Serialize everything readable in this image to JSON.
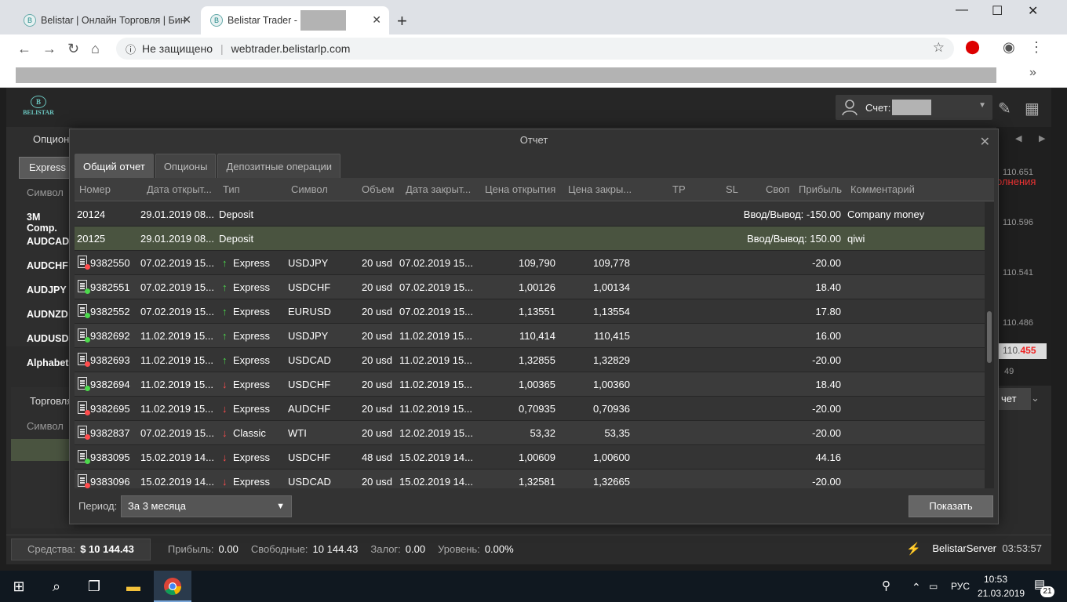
{
  "browser": {
    "tabs": [
      {
        "title": "Belistar | Онлайн Торговля | Бин"
      },
      {
        "title": "Belistar Trader -"
      }
    ],
    "security": "Не защищено",
    "url": "webtrader.belistarlp.com"
  },
  "app": {
    "logo": "BELISTAR",
    "account_label": "Счет:",
    "left_panel": {
      "title": "Опцион",
      "express": "Express",
      "column": "Символ",
      "symbols": [
        "3M Comp.",
        "AUDCAD",
        "AUDCHF",
        "AUDJPY",
        "AUDNZD",
        "AUDUSD",
        "Alphabet ."
      ]
    },
    "left_panel2": {
      "title": "Торговля",
      "column": "Символ"
    },
    "right_prices": [
      "110.651",
      "олнения",
      "110.596",
      "110.541",
      "110.486",
      "110.",
      "455",
      "49"
    ],
    "report_button_partial": "чет",
    "bottom": {
      "funds_label": "Средства:",
      "funds_value": "$ 10 144.43",
      "profit_label": "Прибыль:",
      "profit_value": "0.00",
      "free_label": "Свободные:",
      "free_value": "10 144.43",
      "margin_label": "Залог:",
      "margin_value": "0.00",
      "level_label": "Уровень:",
      "level_value": "0.00%",
      "server": "BelistarServer",
      "time": "03:53:57"
    }
  },
  "modal": {
    "title": "Отчет",
    "tabs": [
      "Общий отчет",
      "Опционы",
      "Депозитные операции"
    ],
    "columns": [
      "Номер",
      "Дата открыт...",
      "Тип",
      "Символ",
      "Объем",
      "Дата закрыт...",
      "Цена открытия",
      "Цена закры...",
      "TP",
      "SL",
      "Своп",
      "Прибыль",
      "Комментарий"
    ],
    "rows": [
      {
        "num": "20124",
        "open": "29.01.2019 08...",
        "dir": "",
        "type": "Deposit",
        "symbol": "",
        "vol": "",
        "close": "",
        "po": "",
        "pc": "",
        "profit": "Ввод/Вывод: -150.00",
        "comment": "Company money",
        "icon": false
      },
      {
        "num": "20125",
        "open": "29.01.2019 08...",
        "dir": "",
        "type": "Deposit",
        "symbol": "",
        "vol": "",
        "close": "",
        "po": "",
        "pc": "",
        "profit": "Ввод/Вывод: 150.00",
        "comment": "qiwi",
        "icon": false
      },
      {
        "num": "9382550",
        "open": "07.02.2019 15...",
        "dir": "up",
        "type": "Express",
        "symbol": "USDJPY",
        "vol": "20 usd",
        "close": "07.02.2019 15...",
        "po": "109,790",
        "pc": "109,778",
        "profit": "-20.00",
        "comment": "",
        "icon": true,
        "win": false
      },
      {
        "num": "9382551",
        "open": "07.02.2019 15...",
        "dir": "up",
        "type": "Express",
        "symbol": "USDCHF",
        "vol": "20 usd",
        "close": "07.02.2019 15...",
        "po": "1,00126",
        "pc": "1,00134",
        "profit": "18.40",
        "comment": "",
        "icon": true,
        "win": true
      },
      {
        "num": "9382552",
        "open": "07.02.2019 15...",
        "dir": "up",
        "type": "Express",
        "symbol": "EURUSD",
        "vol": "20 usd",
        "close": "07.02.2019 15...",
        "po": "1,13551",
        "pc": "1,13554",
        "profit": "17.80",
        "comment": "",
        "icon": true,
        "win": true
      },
      {
        "num": "9382692",
        "open": "11.02.2019 15...",
        "dir": "up",
        "type": "Express",
        "symbol": "USDJPY",
        "vol": "20 usd",
        "close": "11.02.2019 15...",
        "po": "110,414",
        "pc": "110,415",
        "profit": "16.00",
        "comment": "",
        "icon": true,
        "win": true
      },
      {
        "num": "9382693",
        "open": "11.02.2019 15...",
        "dir": "up",
        "type": "Express",
        "symbol": "USDCAD",
        "vol": "20 usd",
        "close": "11.02.2019 15...",
        "po": "1,32855",
        "pc": "1,32829",
        "profit": "-20.00",
        "comment": "",
        "icon": true,
        "win": false
      },
      {
        "num": "9382694",
        "open": "11.02.2019 15...",
        "dir": "down",
        "type": "Express",
        "symbol": "USDCHF",
        "vol": "20 usd",
        "close": "11.02.2019 15...",
        "po": "1,00365",
        "pc": "1,00360",
        "profit": "18.40",
        "comment": "",
        "icon": true,
        "win": true
      },
      {
        "num": "9382695",
        "open": "11.02.2019 15...",
        "dir": "down",
        "type": "Express",
        "symbol": "AUDCHF",
        "vol": "20 usd",
        "close": "11.02.2019 15...",
        "po": "0,70935",
        "pc": "0,70936",
        "profit": "-20.00",
        "comment": "",
        "icon": true,
        "win": false
      },
      {
        "num": "9382837",
        "open": "07.02.2019 15...",
        "dir": "down",
        "type": "Classic",
        "symbol": "WTI",
        "vol": "20 usd",
        "close": "12.02.2019 15...",
        "po": "53,32",
        "pc": "53,35",
        "profit": "-20.00",
        "comment": "",
        "icon": true,
        "win": false
      },
      {
        "num": "9383095",
        "open": "15.02.2019 14...",
        "dir": "down",
        "type": "Express",
        "symbol": "USDCHF",
        "vol": "48 usd",
        "close": "15.02.2019 14...",
        "po": "1,00609",
        "pc": "1,00600",
        "profit": "44.16",
        "comment": "",
        "icon": true,
        "win": true
      },
      {
        "num": "9383096",
        "open": "15.02.2019 14...",
        "dir": "down",
        "type": "Express",
        "symbol": "USDCAD",
        "vol": "20 usd",
        "close": "15.02.2019 14...",
        "po": "1,32581",
        "pc": "1,32665",
        "profit": "-20.00",
        "comment": "",
        "icon": true,
        "win": false
      }
    ],
    "period_label": "Период:",
    "period_value": "За 3 месяца",
    "show_button": "Показать"
  },
  "taskbar": {
    "lang": "РУС",
    "time": "10:53",
    "date": "21.03.2019",
    "notifications": "21"
  }
}
